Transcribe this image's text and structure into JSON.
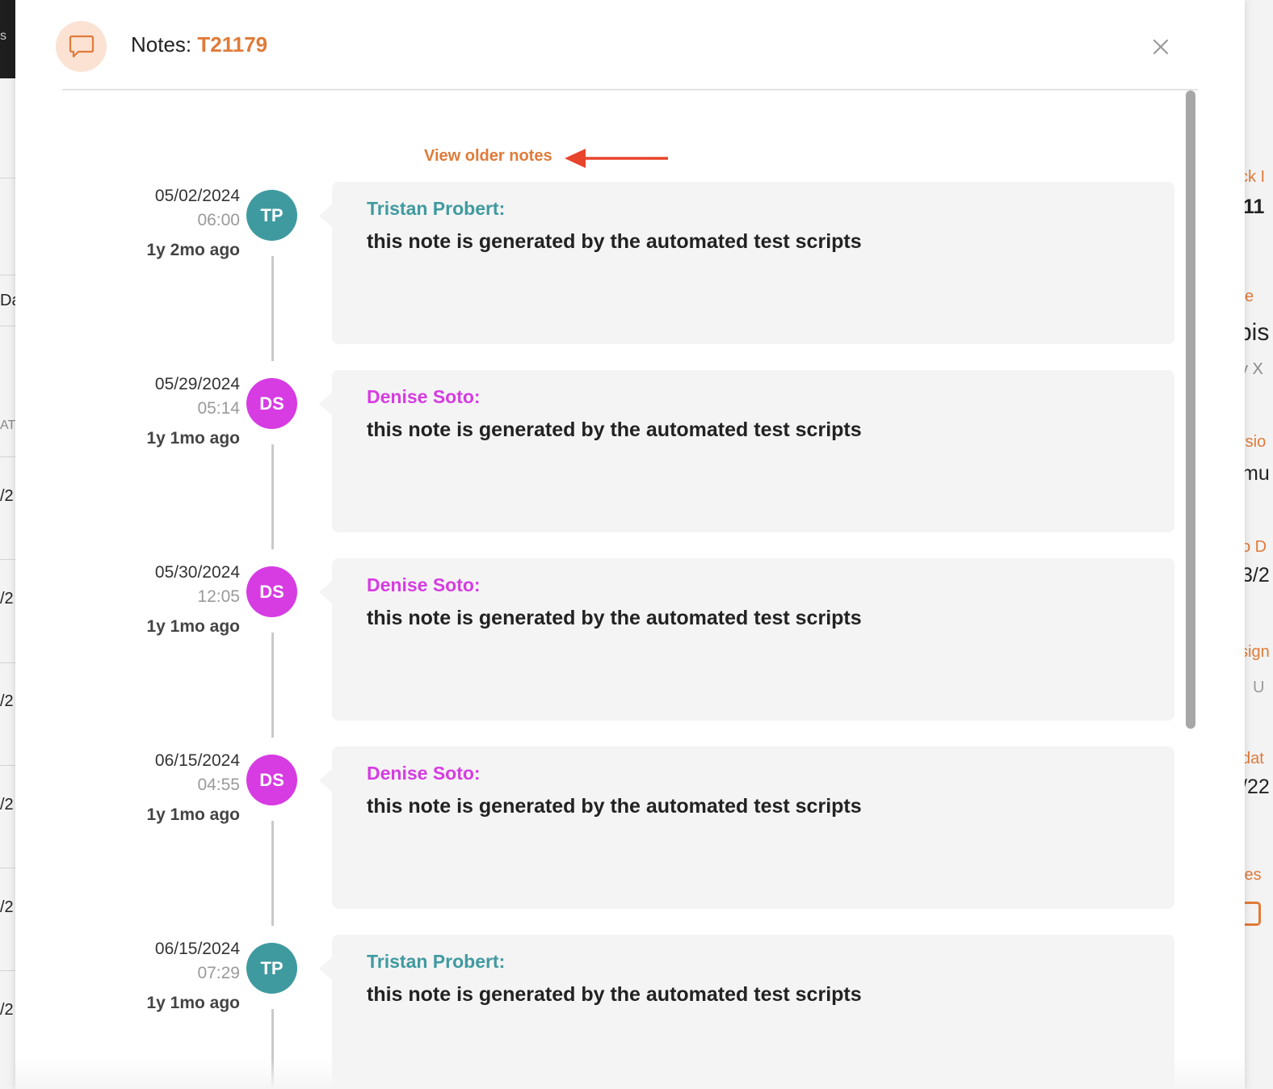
{
  "header": {
    "title_prefix": "Notes:",
    "ticket_id": "T21179",
    "close_label": "×"
  },
  "colors": {
    "accent": "#e07b39",
    "annotation_arrow": "#e8452c",
    "teal_author": "#3f9aa0",
    "magenta_author": "#d63ce2"
  },
  "older_notes_label": "View older notes",
  "notes": [
    {
      "date": "05/02/2024",
      "time": "06:00",
      "ago": "1y 2mo ago",
      "initials": "TP",
      "author": "Tristan Probert:",
      "text": "this note is generated by the automated test scripts",
      "avatar_color": "#3f9aa0"
    },
    {
      "date": "05/29/2024",
      "time": "05:14",
      "ago": "1y 1mo ago",
      "initials": "DS",
      "author": "Denise Soto:",
      "text": "this note is generated by the automated test scripts",
      "avatar_color": "#d63ce2"
    },
    {
      "date": "05/30/2024",
      "time": "12:05",
      "ago": "1y 1mo ago",
      "initials": "DS",
      "author": "Denise Soto:",
      "text": "this note is generated by the automated test scripts",
      "avatar_color": "#d63ce2"
    },
    {
      "date": "06/15/2024",
      "time": "04:55",
      "ago": "1y 1mo ago",
      "initials": "DS",
      "author": "Denise Soto:",
      "text": "this note is generated by the automated test scripts",
      "avatar_color": "#d63ce2"
    },
    {
      "date": "06/15/2024",
      "time": "07:29",
      "ago": "1y 1mo ago",
      "initials": "TP",
      "author": "Tristan Probert:",
      "text": "this note is generated by the automated test scripts",
      "avatar_color": "#3f9aa0"
    }
  ],
  "background": {
    "topbar_text": "s",
    "left_fragments": [
      "Da",
      "AT",
      "/2",
      "/2",
      "/2",
      "/2",
      "/2",
      "/2"
    ],
    "right_fragments": [
      "ck I",
      "11",
      "e",
      "bis",
      "y X",
      "rsio",
      "mu",
      "o D",
      "3/2",
      "sign",
      "U",
      "dat",
      "/22",
      "tes"
    ]
  }
}
